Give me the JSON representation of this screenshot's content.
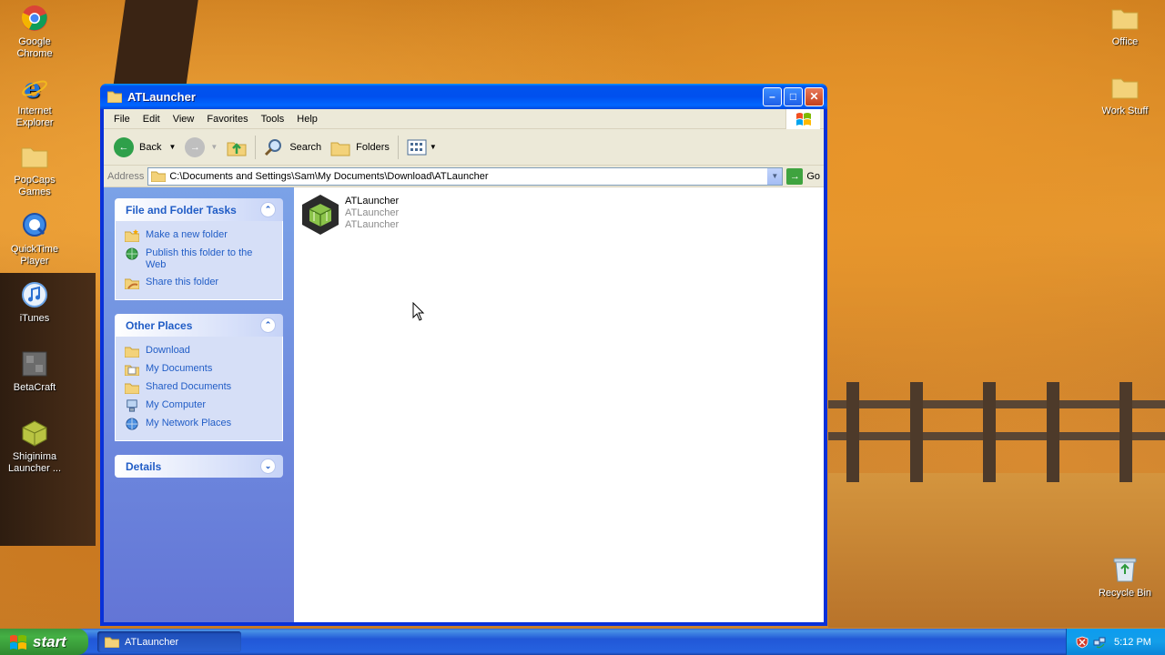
{
  "desktop": {
    "icons_left": [
      {
        "label": "Google Chrome",
        "icon": "chrome-icon"
      },
      {
        "label": "Internet Explorer",
        "icon": "internet-explorer-icon"
      },
      {
        "label": "PopCaps Games",
        "icon": "folder-icon"
      },
      {
        "label": "QuickTime Player",
        "icon": "quicktime-icon"
      },
      {
        "label": "iTunes",
        "icon": "itunes-icon"
      },
      {
        "label": "BetaCraft",
        "icon": "betacraft-icon"
      },
      {
        "label": "Shiginima Launcher ...",
        "icon": "shiginima-icon"
      }
    ],
    "icons_right": [
      {
        "label": "Office",
        "icon": "folder-icon"
      },
      {
        "label": "Work Stuff",
        "icon": "folder-icon"
      },
      {
        "label": "Recycle Bin",
        "icon": "recycle-bin-icon"
      }
    ]
  },
  "window": {
    "title": "ATLauncher",
    "menu": [
      "File",
      "Edit",
      "View",
      "Favorites",
      "Tools",
      "Help"
    ],
    "toolbar": {
      "back_label": "Back",
      "search_label": "Search",
      "folders_label": "Folders"
    },
    "address": {
      "label": "Address",
      "path": "C:\\Documents and Settings\\Sam\\My Documents\\Download\\ATLauncher",
      "go_label": "Go"
    },
    "taskpane": {
      "file_tasks": {
        "title": "File and Folder Tasks",
        "items": [
          "Make a new folder",
          "Publish this folder to the Web",
          "Share this folder"
        ]
      },
      "other_places": {
        "title": "Other Places",
        "items": [
          "Download",
          "My Documents",
          "Shared Documents",
          "My Computer",
          "My Network Places"
        ]
      },
      "details": {
        "title": "Details"
      }
    },
    "files": [
      {
        "name": "ATLauncher",
        "line2": "ATLauncher",
        "line3": "ATLauncher"
      }
    ]
  },
  "taskbar": {
    "start_label": "start",
    "task_label": "ATLauncher",
    "clock": "5:12 PM"
  },
  "colors": {
    "titlebar": "#0058ee",
    "taskpane_link": "#215dc6",
    "start_green": "#3c9a3c"
  }
}
